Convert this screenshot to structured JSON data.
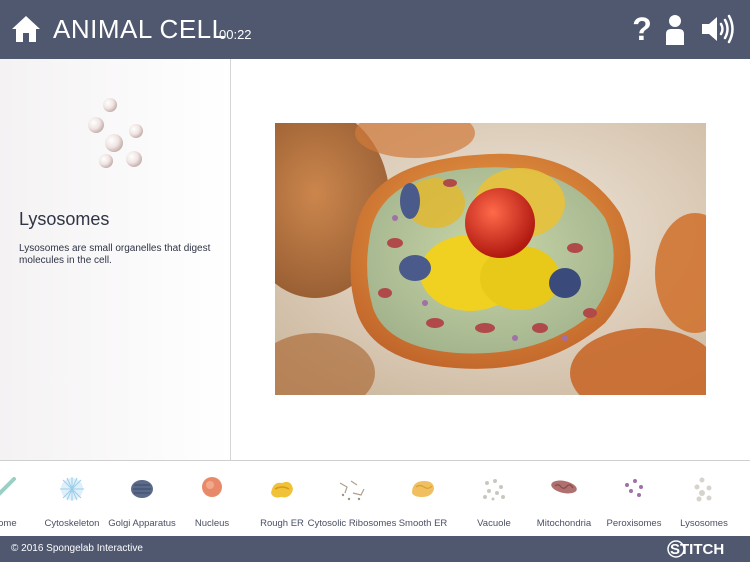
{
  "header": {
    "title": "ANIMAL CELL",
    "timer": "00:22",
    "help_symbol": "?",
    "icons": [
      "home-icon",
      "help-icon",
      "user-icon",
      "speaker-icon"
    ]
  },
  "sidebar": {
    "selected_name": "Lysosomes",
    "description": "Lysosomes are small organelles that digest molecules in the cell."
  },
  "organelles": [
    {
      "label": "some",
      "color": "#9ccfc4"
    },
    {
      "label": "Cytoskeleton",
      "color": "#bcdff1"
    },
    {
      "label": "Golgi Apparatus",
      "color": "#5c6a8a"
    },
    {
      "label": "Nucleus",
      "color": "#e88a6a"
    },
    {
      "label": "Rough ER",
      "color": "#f0c23a"
    },
    {
      "label": "Cytosolic Ribosomes",
      "color": "#b0a090"
    },
    {
      "label": "Smooth ER",
      "color": "#f0c060"
    },
    {
      "label": "Vacuole",
      "color": "#c8c8c0"
    },
    {
      "label": "Mitochondria",
      "color": "#b07070"
    },
    {
      "label": "Peroxisomes",
      "color": "#a070a8"
    },
    {
      "label": "Lysosomes",
      "color": "#d8d2cc"
    }
  ],
  "footer": {
    "copyright": "© 2016 Spongelab Interactive",
    "brand": "STITCH"
  },
  "colors": {
    "header_bg": "#4f586f",
    "footer_bg": "#4f586f",
    "text_dark": "#2f3545"
  }
}
